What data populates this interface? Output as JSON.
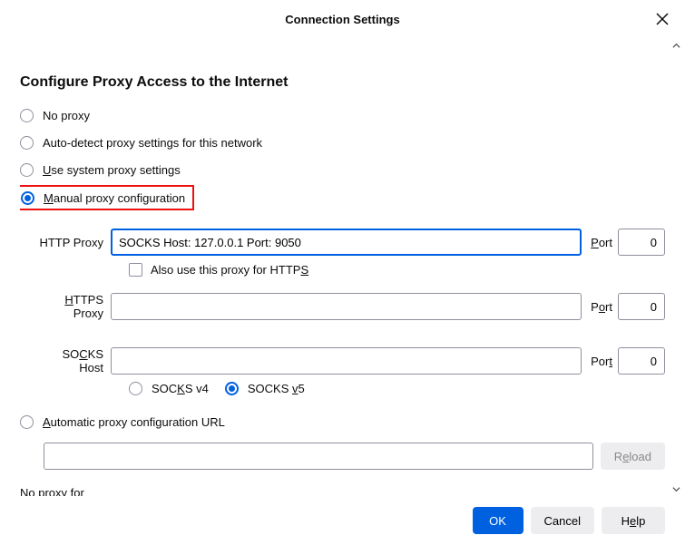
{
  "title": "Connection Settings",
  "section_heading": "Configure Proxy Access to the Internet",
  "radios": {
    "no_proxy": "No proxy",
    "auto_detect": "Auto-detect proxy settings for this network",
    "use_system_pre": "U",
    "use_system_post": "se system proxy settings",
    "manual_pre": "M",
    "manual_post": "anual proxy configuration",
    "auto_url_pre": "A",
    "auto_url_post": "utomatic proxy configuration URL"
  },
  "labels": {
    "http_proxy": "HTTP Proxy",
    "port_pre": "P",
    "port_post": "ort",
    "also_https_pre": "Also use this proxy for HTTP",
    "also_https_ul": "S",
    "https_proxy_pre": "H",
    "https_proxy_post": "TTPS Proxy",
    "port2_pre": "P",
    "port2_ul": "o",
    "port2_post": "rt",
    "socks_host_pre": "SO",
    "socks_host_ul": "C",
    "socks_host_post": "KS Host",
    "port3_pre": "Por",
    "port3_ul": "t",
    "socks_v4_pre": "SOC",
    "socks_v4_ul": "K",
    "socks_v4_post": "S v4",
    "socks_v5_pre": "SOCKS ",
    "socks_v5_ul": "v",
    "socks_v5_post": "5",
    "noproxy_pre": "N",
    "noproxy_post": "o proxy for"
  },
  "values": {
    "http_proxy": "SOCKS Host: 127.0.0.1 Port: 9050",
    "http_port": "0",
    "https_proxy": "",
    "https_port": "0",
    "socks_host": "",
    "socks_port": "0",
    "auto_url": "",
    "no_proxy_for": ""
  },
  "buttons": {
    "reload_pre": "R",
    "reload_ul": "e",
    "reload_post": "load",
    "ok": "OK",
    "cancel": "Cancel",
    "help_pre": "H",
    "help_ul": "e",
    "help_post": "lp"
  }
}
